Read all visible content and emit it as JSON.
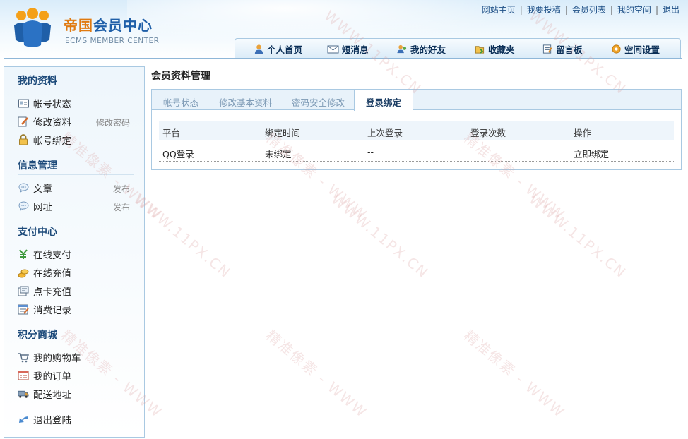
{
  "brand": {
    "title_part1": "帝国",
    "title_part2": "会员中心",
    "subtitle": "ECMS MEMBER CENTER",
    "accent_orange": "#e07a10",
    "accent_blue": "#1f5fa8"
  },
  "top_links": [
    "网站主页",
    "我要投稿",
    "会员列表",
    "我的空间",
    "退出"
  ],
  "nav": [
    {
      "label": "个人首页",
      "icon": "user-icon"
    },
    {
      "label": "短消息",
      "icon": "envelope-icon"
    },
    {
      "label": "我的好友",
      "icon": "friends-icon"
    },
    {
      "label": "收藏夹",
      "icon": "favorites-icon"
    },
    {
      "label": "留言板",
      "icon": "guestbook-icon"
    },
    {
      "label": "空间设置",
      "icon": "settings-icon"
    }
  ],
  "sidebar": {
    "sections": [
      {
        "title": "我的资料"
      },
      {
        "title": "信息管理"
      },
      {
        "title": "支付中心"
      },
      {
        "title": "积分商城"
      }
    ],
    "items": [
      {
        "label": "帐号状态",
        "icon": "id-card-icon"
      },
      {
        "label": "修改资料",
        "icon": "edit-icon",
        "extra": "修改密码"
      },
      {
        "label": "帐号绑定",
        "icon": "lock-icon"
      },
      {
        "label": "文章",
        "icon": "chat-bubble-icon",
        "extra": "发布"
      },
      {
        "label": "网址",
        "icon": "chat-bubble-icon",
        "extra": "发布"
      },
      {
        "label": "在线支付",
        "icon": "yen-icon"
      },
      {
        "label": "在线充值",
        "icon": "coins-icon"
      },
      {
        "label": "点卡充值",
        "icon": "card-icon"
      },
      {
        "label": "消费记录",
        "icon": "record-icon"
      },
      {
        "label": "我的购物车",
        "icon": "cart-icon"
      },
      {
        "label": "我的订单",
        "icon": "order-icon"
      },
      {
        "label": "配送地址",
        "icon": "truck-icon"
      },
      {
        "label": "退出登陆",
        "icon": "back-arrow-icon"
      }
    ]
  },
  "main": {
    "title": "会员资料管理",
    "tabs": [
      {
        "label": "帐号状态",
        "active": false
      },
      {
        "label": "修改基本资料",
        "active": false
      },
      {
        "label": "密码安全修改",
        "active": false
      },
      {
        "label": "登录绑定",
        "active": true
      }
    ],
    "table": {
      "headers": [
        "平台",
        "绑定时间",
        "上次登录",
        "登录次数",
        "操作"
      ],
      "rows": [
        [
          "QQ登录",
          "未绑定",
          "--",
          "",
          "立即绑定"
        ]
      ]
    }
  },
  "watermarks": [
    "WWW.11PX.CN",
    "精准像素 - WWW"
  ]
}
